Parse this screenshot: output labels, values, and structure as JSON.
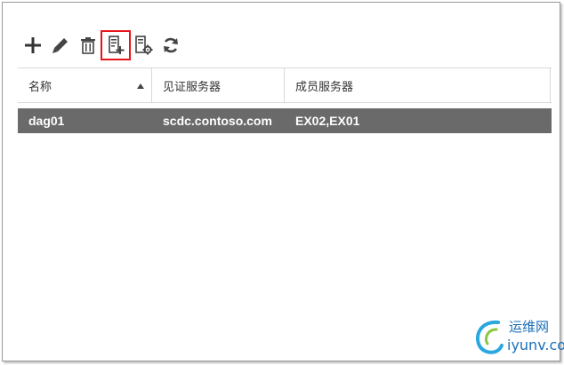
{
  "toolbar": {
    "buttons": [
      {
        "icon": "plus-icon"
      },
      {
        "icon": "pencil-icon"
      },
      {
        "icon": "trash-icon"
      },
      {
        "icon": "add-member-server-icon",
        "highlighted": true
      },
      {
        "icon": "manage-server-icon"
      },
      {
        "icon": "refresh-icon"
      }
    ]
  },
  "table": {
    "columns": [
      "名称",
      "见证服务器",
      "成员服务器"
    ],
    "sort": {
      "column": "名称",
      "direction": "ascending"
    },
    "rows": [
      {
        "name": "dag01",
        "witness_server": "scdc.contoso.com",
        "member_servers": "EX02,EX01",
        "selected": true
      }
    ]
  },
  "watermark": {
    "cn": "运维网",
    "en": "iyunv.com"
  },
  "colors": {
    "highlight": "#e8131b",
    "selected_row": "#6a6a6a",
    "brand": "#1b6fb8"
  }
}
